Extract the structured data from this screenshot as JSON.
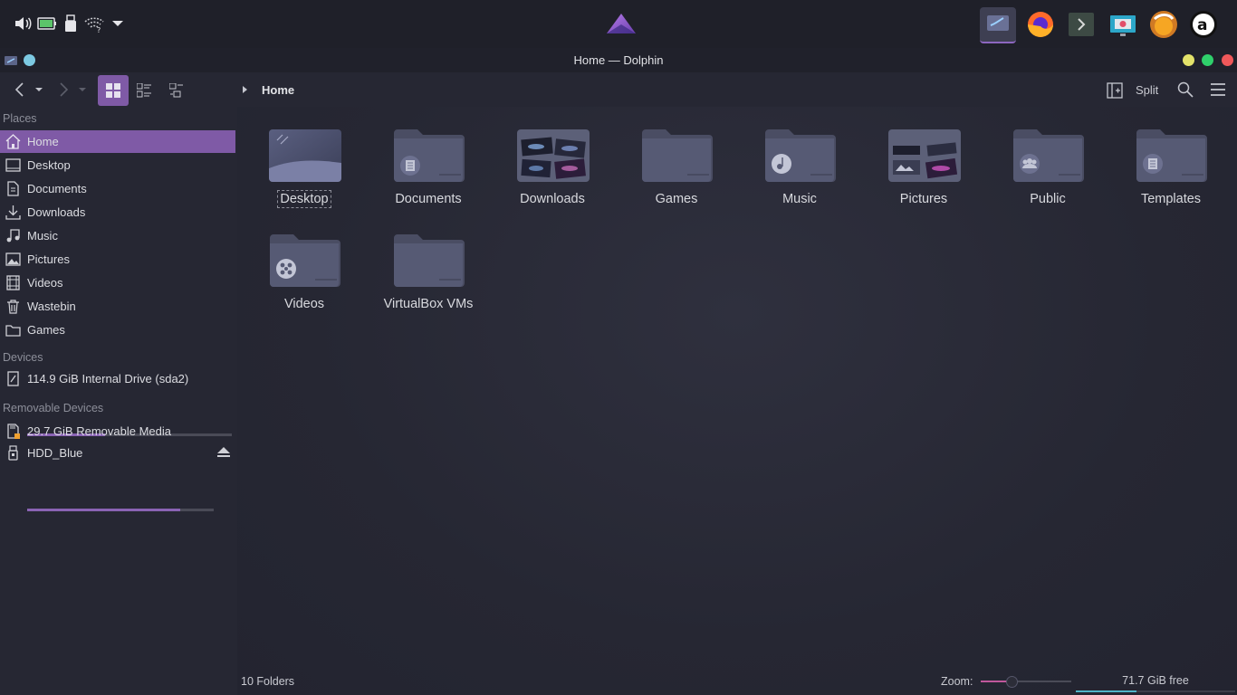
{
  "window": {
    "title": "Home — Dolphin"
  },
  "toolbar": {
    "breadcrumb": "Home",
    "split_label": "Split"
  },
  "sidebar": {
    "places_heading": "Places",
    "places": [
      {
        "label": "Home",
        "icon": "home-icon"
      },
      {
        "label": "Desktop",
        "icon": "desktop-icon"
      },
      {
        "label": "Documents",
        "icon": "documents-icon"
      },
      {
        "label": "Downloads",
        "icon": "downloads-icon"
      },
      {
        "label": "Music",
        "icon": "music-icon"
      },
      {
        "label": "Pictures",
        "icon": "pictures-icon"
      },
      {
        "label": "Videos",
        "icon": "videos-icon"
      },
      {
        "label": "Wastebin",
        "icon": "wastebin-icon"
      },
      {
        "label": "Games",
        "icon": "games-icon"
      }
    ],
    "devices_heading": "Devices",
    "devices": [
      {
        "label": "114.9 GiB Internal Drive (sda2)",
        "usage": 0.38
      }
    ],
    "removable_heading": "Removable Devices",
    "removable": [
      {
        "label": "29.7 GiB Removable Media"
      },
      {
        "label": "HDD_Blue",
        "usage": 0.82
      }
    ]
  },
  "main": {
    "items": [
      {
        "name": "Desktop",
        "icon": "desktop-folder-icon"
      },
      {
        "name": "Documents",
        "icon": "documents-folder-icon"
      },
      {
        "name": "Downloads",
        "icon": "downloads-folder-icon"
      },
      {
        "name": "Games",
        "icon": "folder-icon"
      },
      {
        "name": "Music",
        "icon": "music-folder-icon"
      },
      {
        "name": "Pictures",
        "icon": "pictures-folder-icon"
      },
      {
        "name": "Public",
        "icon": "public-folder-icon"
      },
      {
        "name": "Templates",
        "icon": "templates-folder-icon"
      },
      {
        "name": "Videos",
        "icon": "videos-folder-icon"
      },
      {
        "name": "VirtualBox VMs",
        "icon": "folder-icon"
      }
    ]
  },
  "statusbar": {
    "folder_count": "10 Folders",
    "zoom_label": "Zoom:",
    "zoom_level": 0.33,
    "free_space": "71.7 GiB free",
    "disk_usage": 0.38
  },
  "colors": {
    "accent": "#7f5aa6",
    "panel_bg": "#1f2029",
    "window_bg": "#262733",
    "folder": "#4e5168",
    "close": "#f0585a",
    "maximize": "#2fd06b",
    "minimize": "#e3e26a"
  }
}
